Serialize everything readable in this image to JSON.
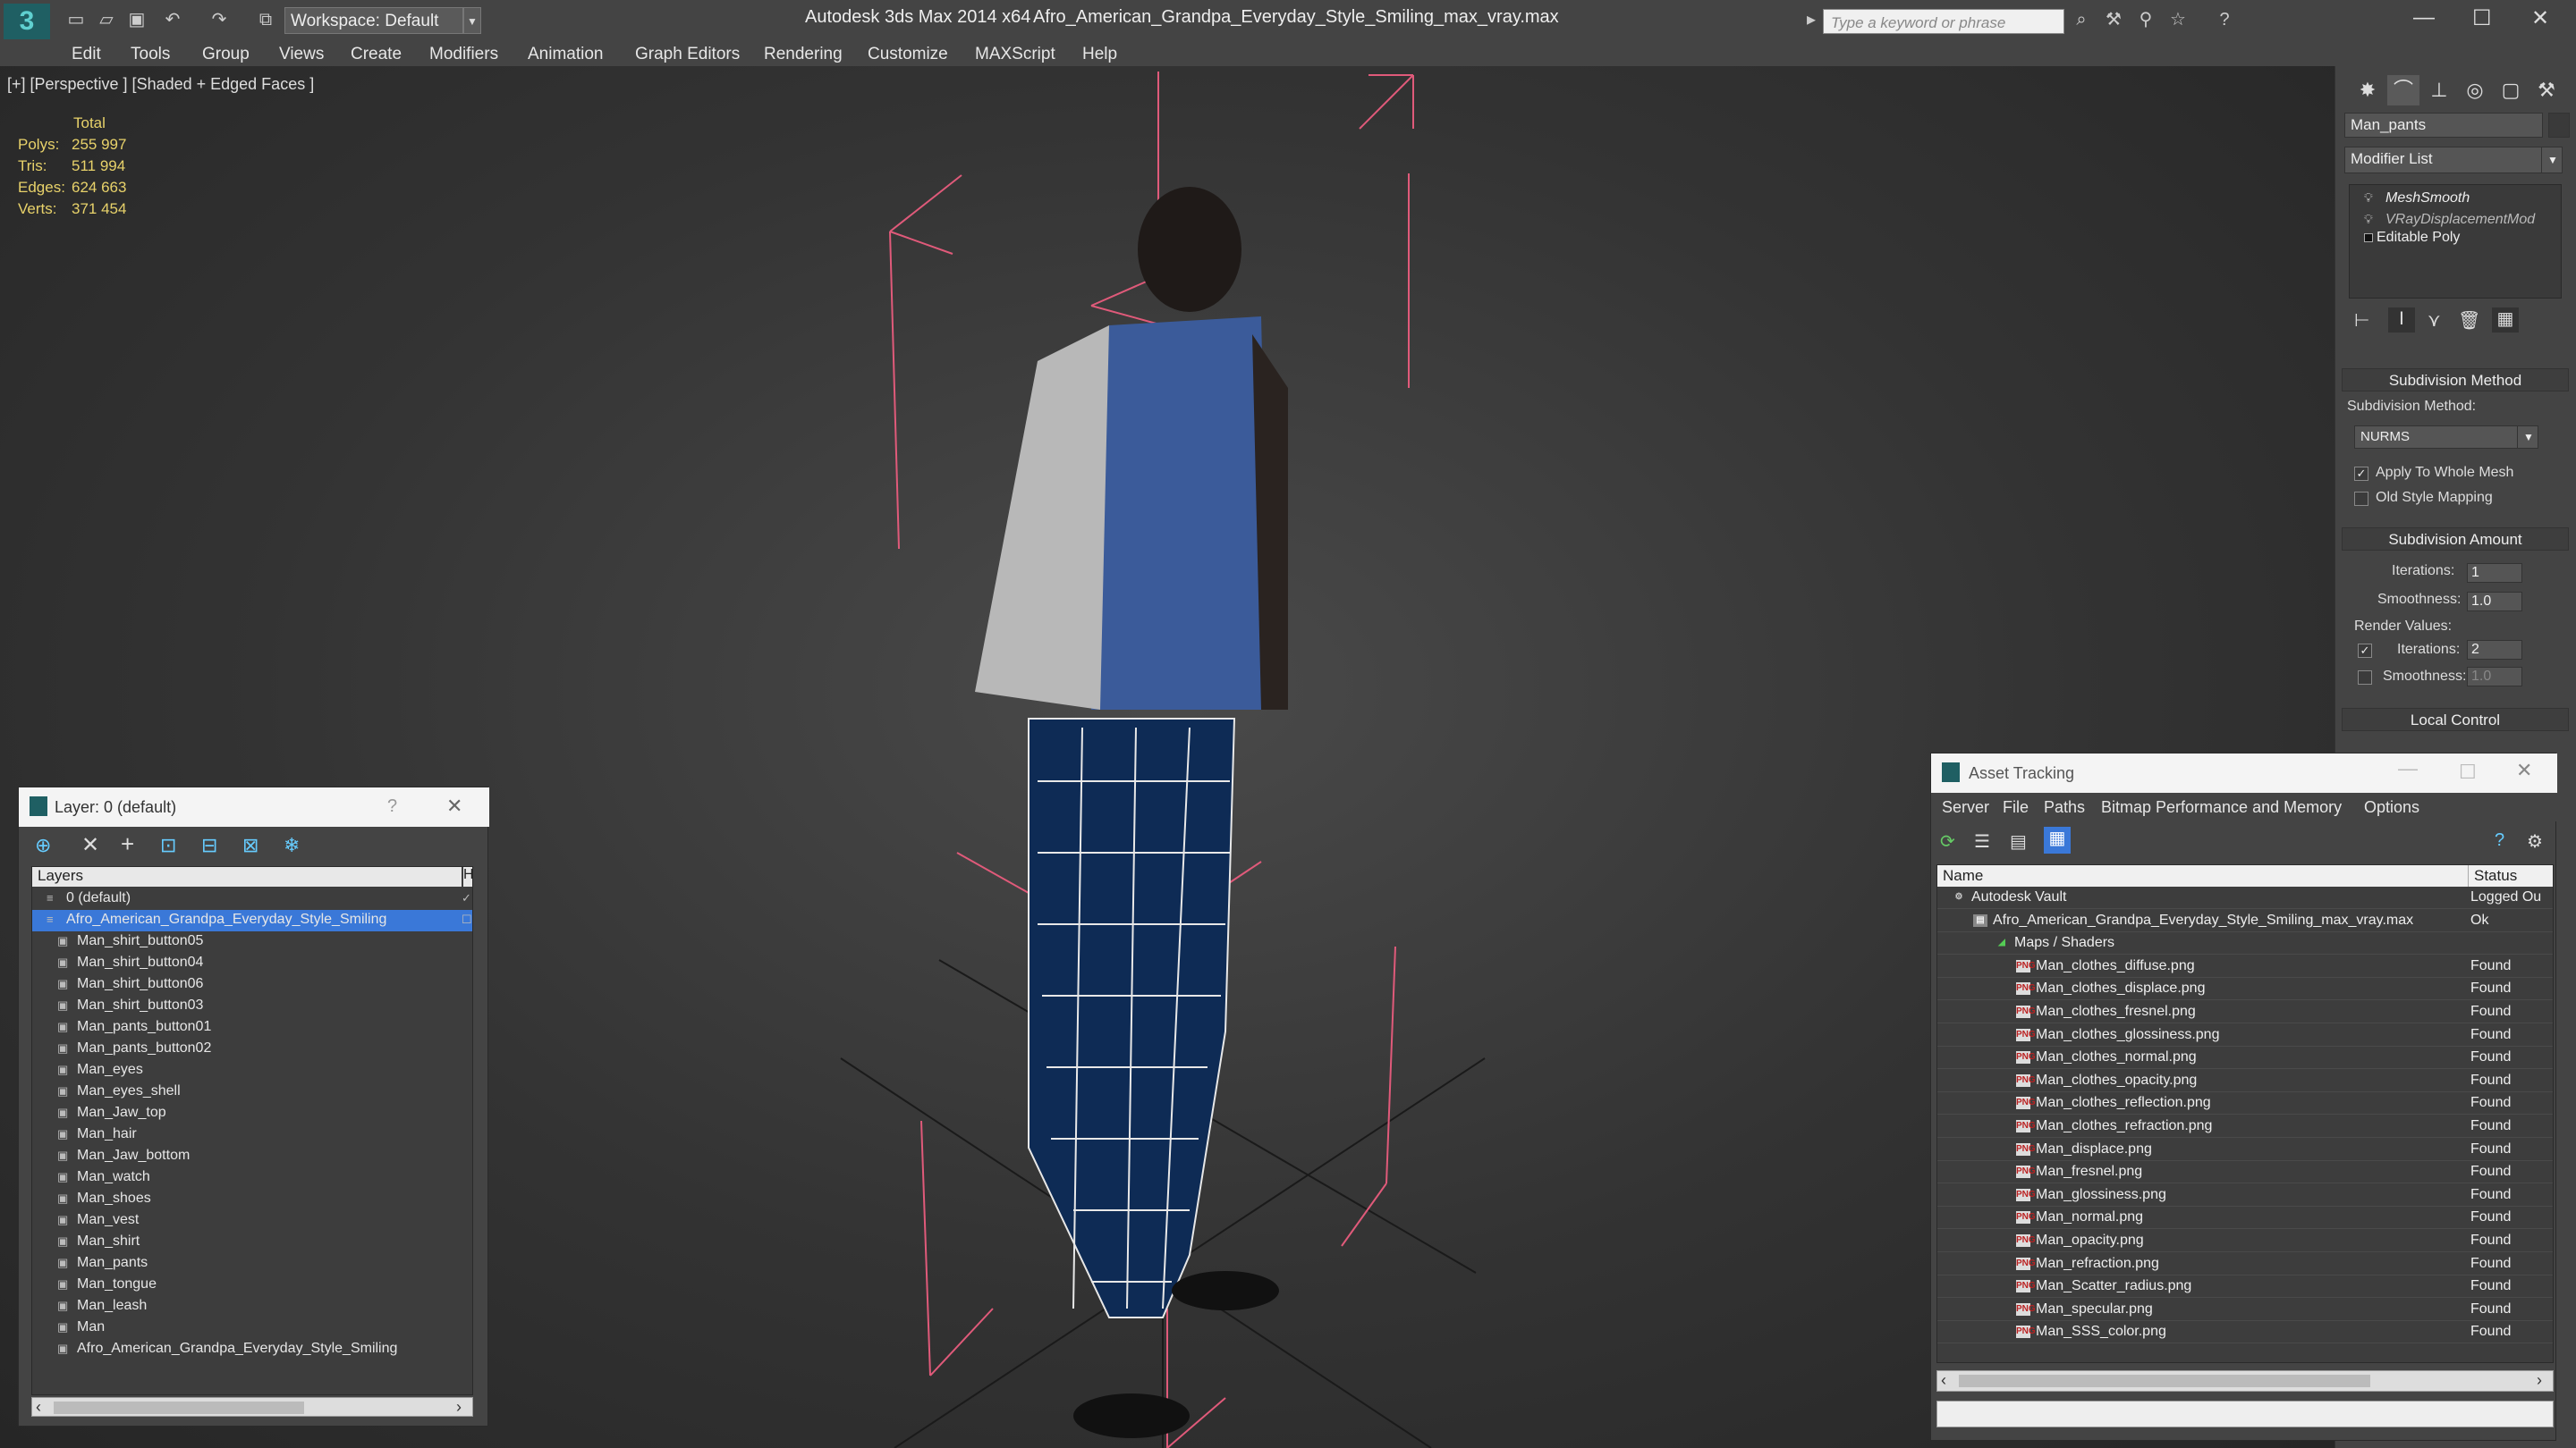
{
  "titlebar": {
    "workspace": "Workspace: Default",
    "app_title": "Autodesk 3ds Max  2014 x64",
    "file_title": "Afro_American_Grandpa_Everyday_Style_Smiling_max_vray.max",
    "search_placeholder": "Type a keyword or phrase"
  },
  "menu": [
    "Edit",
    "Tools",
    "Group",
    "Views",
    "Create",
    "Modifiers",
    "Animation",
    "Graph Editors",
    "Rendering",
    "Customize",
    "MAXScript",
    "Help"
  ],
  "viewport": {
    "label": "[+] [Perspective ] [Shaded + Edged Faces ]",
    "stats_header": "Total",
    "stats": [
      {
        "label": "Polys:",
        "value": "255 997"
      },
      {
        "label": "Tris:",
        "value": "511 994"
      },
      {
        "label": "Edges:",
        "value": "624 663"
      },
      {
        "label": "Verts:",
        "value": "371 454"
      }
    ]
  },
  "command_panel": {
    "object_name": "Man_pants",
    "modifier_list": "Modifier List",
    "stack": [
      "MeshSmooth",
      "VRayDisplacementMod",
      "Editable Poly"
    ],
    "subdivision_method_title": "Subdivision Method",
    "subdivision_method_label": "Subdivision Method:",
    "subdivision_method_value": "NURMS",
    "apply_whole_mesh": "Apply To Whole Mesh",
    "old_style_mapping": "Old Style Mapping",
    "subdivision_amount_title": "Subdivision Amount",
    "iterations_label": "Iterations:",
    "iterations_value": "1",
    "smoothness_label": "Smoothness:",
    "smoothness_value": "1.0",
    "render_values_label": "Render Values:",
    "render_iterations_label": "Iterations:",
    "render_iterations_value": "2",
    "render_smoothness_label": "Smoothness:",
    "render_smoothness_value": "1.0",
    "local_control_title": "Local Control"
  },
  "layer_dialog": {
    "title": "Layer: 0 (default)",
    "help": "?",
    "col_layers": "Layers",
    "col_h": "H",
    "layers": [
      {
        "label": "0 (default)",
        "level": 1,
        "selected": false
      },
      {
        "label": "Afro_American_Grandpa_Everyday_Style_Smiling",
        "level": 1,
        "selected": true
      },
      {
        "label": "Man_shirt_button05",
        "level": 2,
        "selected": false
      },
      {
        "label": "Man_shirt_button04",
        "level": 2,
        "selected": false
      },
      {
        "label": "Man_shirt_button06",
        "level": 2,
        "selected": false
      },
      {
        "label": "Man_shirt_button03",
        "level": 2,
        "selected": false
      },
      {
        "label": "Man_pants_button01",
        "level": 2,
        "selected": false
      },
      {
        "label": "Man_pants_button02",
        "level": 2,
        "selected": false
      },
      {
        "label": "Man_eyes",
        "level": 2,
        "selected": false
      },
      {
        "label": "Man_eyes_shell",
        "level": 2,
        "selected": false
      },
      {
        "label": "Man_Jaw_top",
        "level": 2,
        "selected": false
      },
      {
        "label": "Man_hair",
        "level": 2,
        "selected": false
      },
      {
        "label": "Man_Jaw_bottom",
        "level": 2,
        "selected": false
      },
      {
        "label": "Man_watch",
        "level": 2,
        "selected": false
      },
      {
        "label": "Man_shoes",
        "level": 2,
        "selected": false
      },
      {
        "label": "Man_vest",
        "level": 2,
        "selected": false
      },
      {
        "label": "Man_shirt",
        "level": 2,
        "selected": false
      },
      {
        "label": "Man_pants",
        "level": 2,
        "selected": false
      },
      {
        "label": "Man_tongue",
        "level": 2,
        "selected": false
      },
      {
        "label": "Man_leash",
        "level": 2,
        "selected": false
      },
      {
        "label": "Man",
        "level": 2,
        "selected": false
      },
      {
        "label": "Afro_American_Grandpa_Everyday_Style_Smiling",
        "level": 2,
        "selected": false
      }
    ]
  },
  "asset_dialog": {
    "title": "Asset Tracking",
    "menu": [
      "Server",
      "File",
      "Paths",
      "Bitmap Performance and Memory",
      "Options"
    ],
    "col_name": "Name",
    "col_status": "Status",
    "rows": [
      {
        "name": "Autodesk Vault",
        "status": "Logged Ou",
        "indent": 0,
        "kind": "vault"
      },
      {
        "name": "Afro_American_Grandpa_Everyday_Style_Smiling_max_vray.max",
        "status": "Ok",
        "indent": 1,
        "kind": "file"
      },
      {
        "name": "Maps / Shaders",
        "status": "",
        "indent": 2,
        "kind": "folder"
      },
      {
        "name": "Man_clothes_diffuse.png",
        "status": "Found",
        "indent": 3,
        "kind": "png"
      },
      {
        "name": "Man_clothes_displace.png",
        "status": "Found",
        "indent": 3,
        "kind": "png"
      },
      {
        "name": "Man_clothes_fresnel.png",
        "status": "Found",
        "indent": 3,
        "kind": "png"
      },
      {
        "name": "Man_clothes_glossiness.png",
        "status": "Found",
        "indent": 3,
        "kind": "png"
      },
      {
        "name": "Man_clothes_normal.png",
        "status": "Found",
        "indent": 3,
        "kind": "png"
      },
      {
        "name": "Man_clothes_opacity.png",
        "status": "Found",
        "indent": 3,
        "kind": "png"
      },
      {
        "name": "Man_clothes_reflection.png",
        "status": "Found",
        "indent": 3,
        "kind": "png"
      },
      {
        "name": "Man_clothes_refraction.png",
        "status": "Found",
        "indent": 3,
        "kind": "png"
      },
      {
        "name": "Man_displace.png",
        "status": "Found",
        "indent": 3,
        "kind": "png"
      },
      {
        "name": "Man_fresnel.png",
        "status": "Found",
        "indent": 3,
        "kind": "png"
      },
      {
        "name": "Man_glossiness.png",
        "status": "Found",
        "indent": 3,
        "kind": "png"
      },
      {
        "name": "Man_normal.png",
        "status": "Found",
        "indent": 3,
        "kind": "png"
      },
      {
        "name": "Man_opacity.png",
        "status": "Found",
        "indent": 3,
        "kind": "png"
      },
      {
        "name": "Man_refraction.png",
        "status": "Found",
        "indent": 3,
        "kind": "png"
      },
      {
        "name": "Man_Scatter_radius.png",
        "status": "Found",
        "indent": 3,
        "kind": "png"
      },
      {
        "name": "Man_specular.png",
        "status": "Found",
        "indent": 3,
        "kind": "png"
      },
      {
        "name": "Man_SSS_color.png",
        "status": "Found",
        "indent": 3,
        "kind": "png"
      }
    ]
  }
}
